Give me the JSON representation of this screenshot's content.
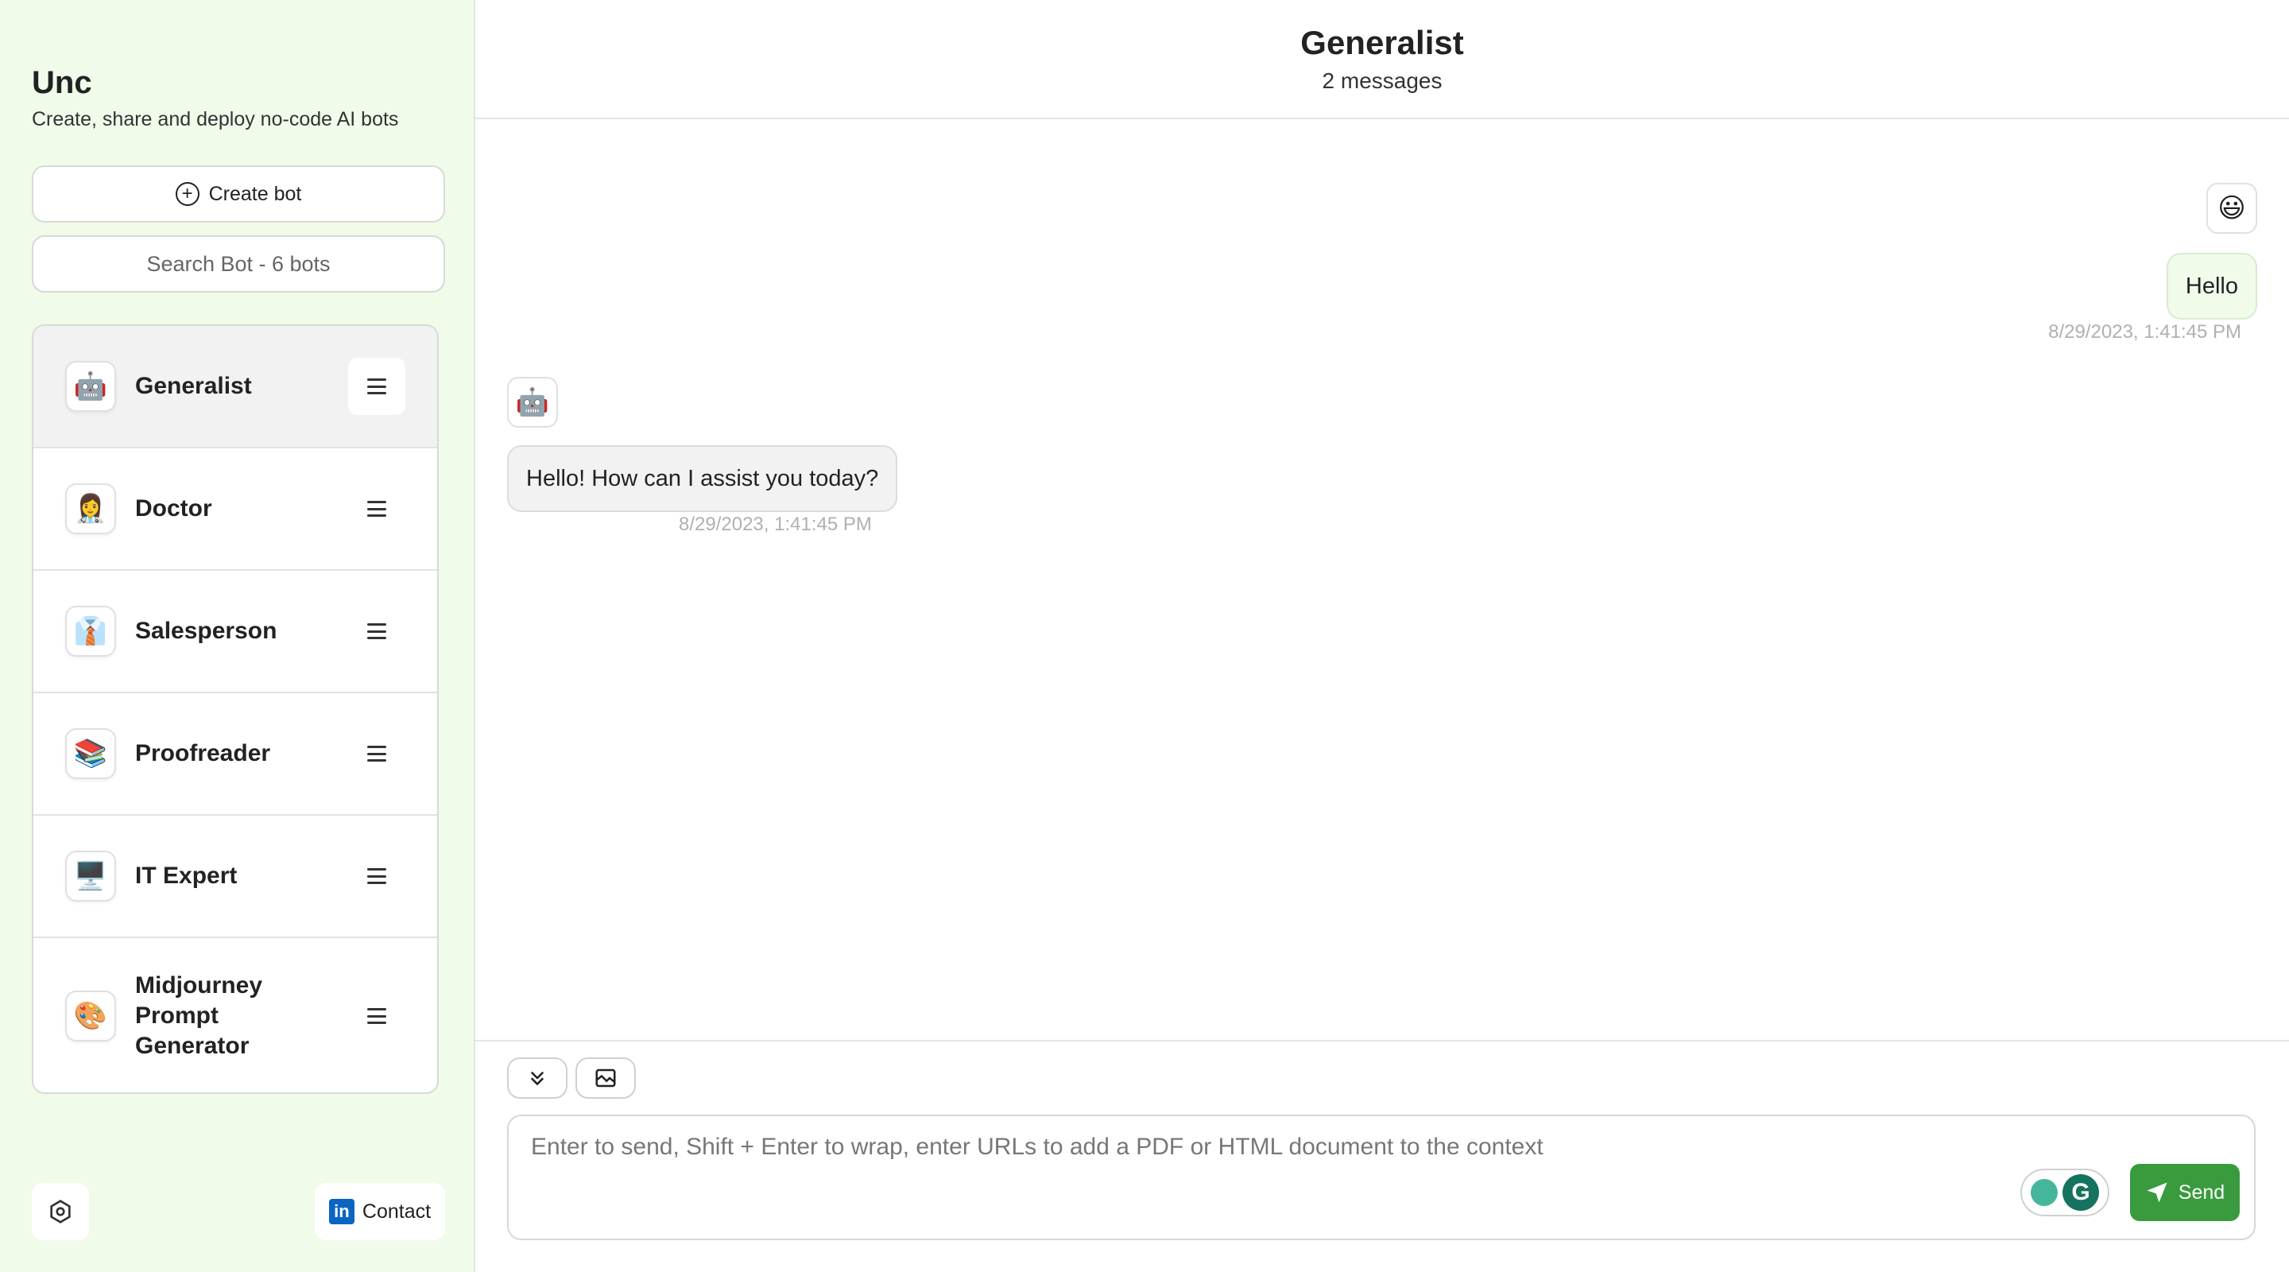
{
  "sidebar": {
    "app_name": "Unc",
    "tagline": "Create, share and deploy no-code AI bots",
    "create_label": "Create bot",
    "search_placeholder": "Search Bot - 6 bots",
    "bots": [
      {
        "name": "Generalist",
        "emoji": "🤖",
        "active": true
      },
      {
        "name": "Doctor",
        "emoji": "👩‍⚕️"
      },
      {
        "name": "Salesperson",
        "emoji": "👔"
      },
      {
        "name": "Proofreader",
        "emoji": "📚"
      },
      {
        "name": "IT Expert",
        "emoji": "🖥️"
      },
      {
        "name": "Midjourney Prompt Generator",
        "emoji": "🎨"
      }
    ],
    "contact_label": "Contact",
    "linkedin_glyph": "in"
  },
  "chat": {
    "title": "Generalist",
    "count": "2 messages",
    "messages": [
      {
        "role": "user",
        "avatar": "😃",
        "text": "Hello",
        "time": "8/29/2023, 1:41:45 PM"
      },
      {
        "role": "bot",
        "avatar": "🤖",
        "text": "Hello! How can I assist you today?",
        "time": "8/29/2023, 1:41:45 PM"
      }
    ]
  },
  "composer": {
    "placeholder": "Enter to send, Shift + Enter to wrap, enter URLs to add a PDF or HTML document to the context",
    "send_label": "Send",
    "grammarly_glyph": "G"
  },
  "colors": {
    "sidebar_bg": "#f0fbea",
    "send_button": "#3a9b3e",
    "linkedin": "#0a66c2"
  }
}
